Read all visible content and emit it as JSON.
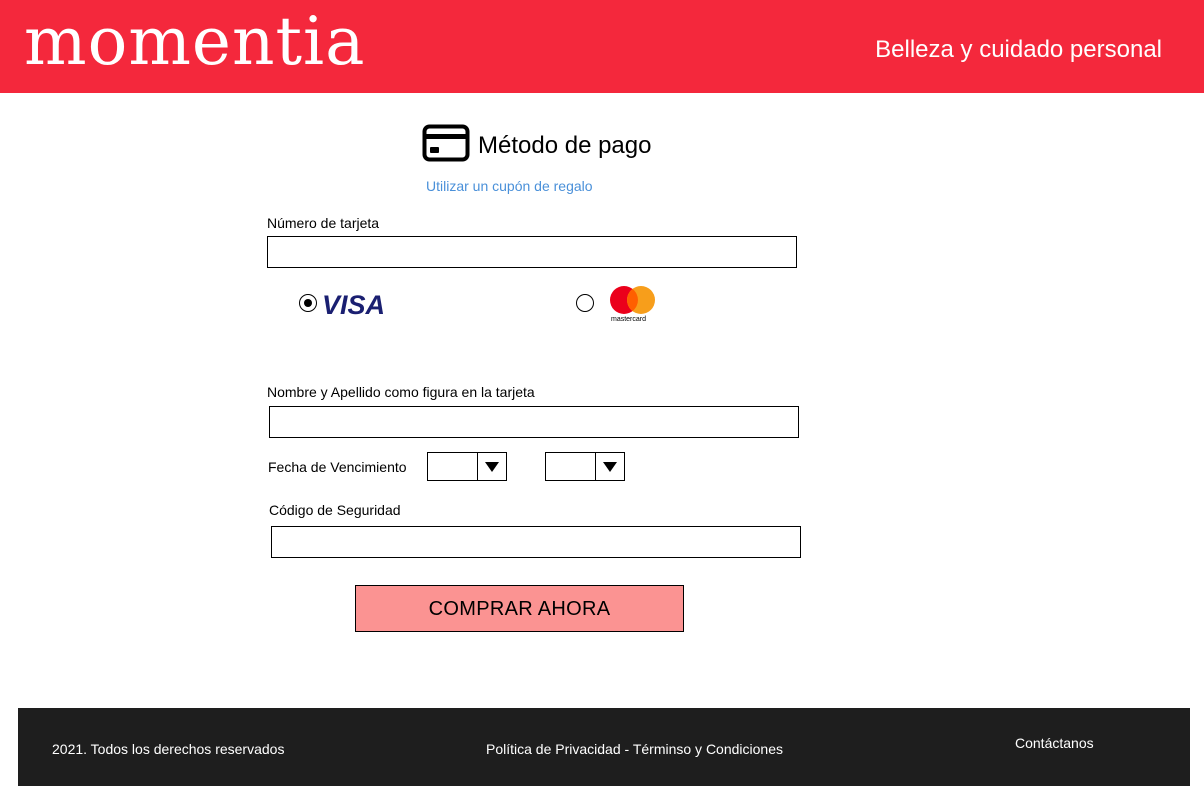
{
  "header": {
    "logo": "momentia",
    "tagline": "Belleza y cuidado personal"
  },
  "payment": {
    "title": "Método de pago",
    "title_icon": "credit-card-icon",
    "coupon_link": "Utilizar un cupón de regalo",
    "card_number_label": "Número de tarjeta",
    "card_number_value": "",
    "card_brands": [
      {
        "name": "VISA",
        "selected": true
      },
      {
        "name": "mastercard",
        "selected": false
      }
    ],
    "name_label": "Nombre y Apellido como figura en la tarjeta",
    "name_value": "",
    "expiry_label": "Fecha de Vencimiento",
    "expiry_month_value": "",
    "expiry_year_value": "",
    "security_code_label": "Código de Seguridad",
    "security_code_value": "",
    "buy_button": "COMPRAR AHORA"
  },
  "footer": {
    "copyright": "2021. Todos los derechos reservados",
    "legal": "Política de Privacidad - Términso y Condiciones",
    "contact": "Contáctanos"
  },
  "colors": {
    "brand_red": "#f4283c",
    "button_pink": "#fb9392",
    "link_blue": "#4a90d9",
    "footer_dark": "#1e1e1e",
    "visa_blue": "#1a1f71",
    "mc_red": "#eb001b",
    "mc_orange": "#f79e1b"
  }
}
